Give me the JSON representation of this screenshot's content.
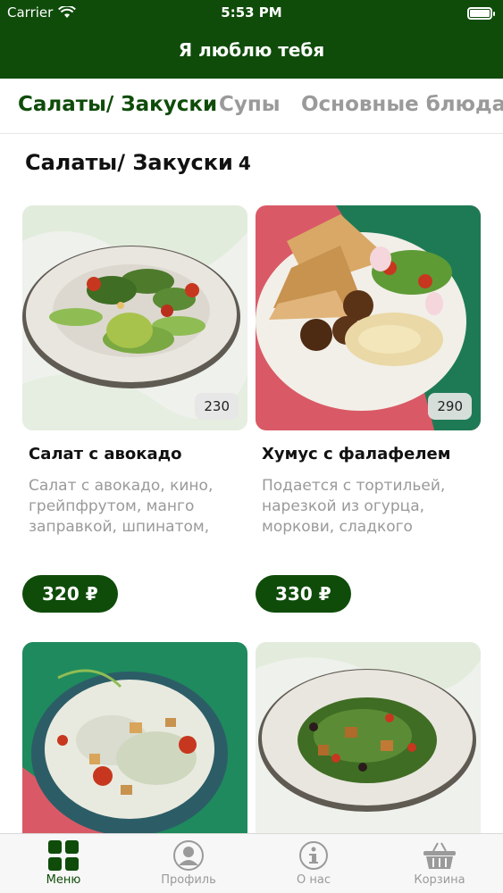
{
  "status_bar": {
    "carrier": "Carrier",
    "time": "5:53 PM"
  },
  "header": {
    "title": "Я люблю тебя"
  },
  "category_tabs": [
    {
      "label": "Салаты/ Закуски",
      "active": true
    },
    {
      "label": "Супы",
      "active": false
    },
    {
      "label": "Основные блюда",
      "active": false
    }
  ],
  "section": {
    "title": "Салаты/ Закуски",
    "count": "4"
  },
  "products": [
    {
      "name": "Салат с авокадо",
      "description": "Салат с авокадо, кино, грейпфрутом, манго заправкой, шпинатом,",
      "weight": "230",
      "price": "320 ₽"
    },
    {
      "name": "Хумус с фалафелем",
      "description": "Подается с тортильей, нарезкой из огурца, моркови, сладкого",
      "weight": "290",
      "price": "330 ₽"
    },
    {
      "name": "",
      "description": "",
      "weight": "",
      "price": ""
    },
    {
      "name": "",
      "description": "",
      "weight": "",
      "price": ""
    }
  ],
  "tab_bar": [
    {
      "label": "Меню",
      "icon": "grid-icon",
      "active": true
    },
    {
      "label": "Профиль",
      "icon": "person-icon",
      "active": false
    },
    {
      "label": "О нас",
      "icon": "info-person-icon",
      "active": false
    },
    {
      "label": "Корзина",
      "icon": "basket-icon",
      "active": false
    }
  ],
  "colors": {
    "brand_green": "#0f4c0a",
    "inactive_gray": "#9a9a9a"
  }
}
